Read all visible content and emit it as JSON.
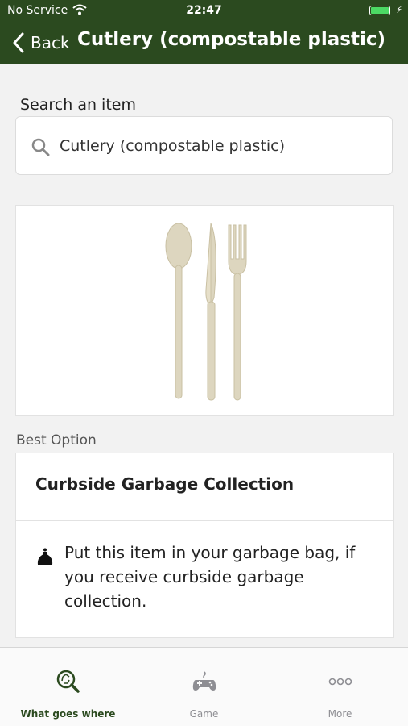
{
  "status_bar": {
    "carrier": "No Service",
    "time": "22:47",
    "battery_level": 1.0
  },
  "nav": {
    "back_label": "Back",
    "title": "Cutlery (compostable plastic)"
  },
  "search": {
    "label": "Search an item",
    "value": "Cutlery (compostable plastic)",
    "icon": "search-icon"
  },
  "item_image": {
    "icon": "cutlery-image"
  },
  "best_option": {
    "section_label": "Best Option",
    "title": "Curbside Garbage Collection",
    "icon": "garbage-bag-icon",
    "description": "Put this item in your garbage bag, if you receive curbside garbage collection."
  },
  "tabs": [
    {
      "label": "What goes where",
      "icon": "recycle-search-icon",
      "active": true
    },
    {
      "label": "Game",
      "icon": "gamepad-icon",
      "active": false
    },
    {
      "label": "More",
      "icon": "more-dots-icon",
      "active": false
    }
  ],
  "colors": {
    "header": "#2b4a1f",
    "accent": "#2b4a1f",
    "inactive_tab": "#8e8e93",
    "battery": "#4cd964"
  }
}
